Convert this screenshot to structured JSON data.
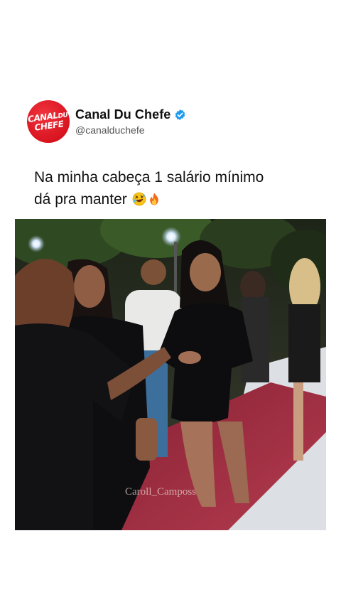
{
  "post": {
    "account_name": "Canal Du Chefe",
    "account_handle": "@canalduchefe",
    "avatar_logo_text": "CANAL DU CHEFE",
    "verified": true,
    "caption_line1": "Na minha cabeça 1 salário mínimo",
    "caption_line2": "dá pra manter",
    "caption_emojis": [
      "rolling-on-floor-laughing-emoji",
      "fire-emoji"
    ],
    "media_watermark": "Caroll_Camposs"
  },
  "colors": {
    "brand_red": "#d8141f",
    "verified_blue": "#1d9bf0",
    "text": "#111111",
    "handle": "#555555"
  }
}
